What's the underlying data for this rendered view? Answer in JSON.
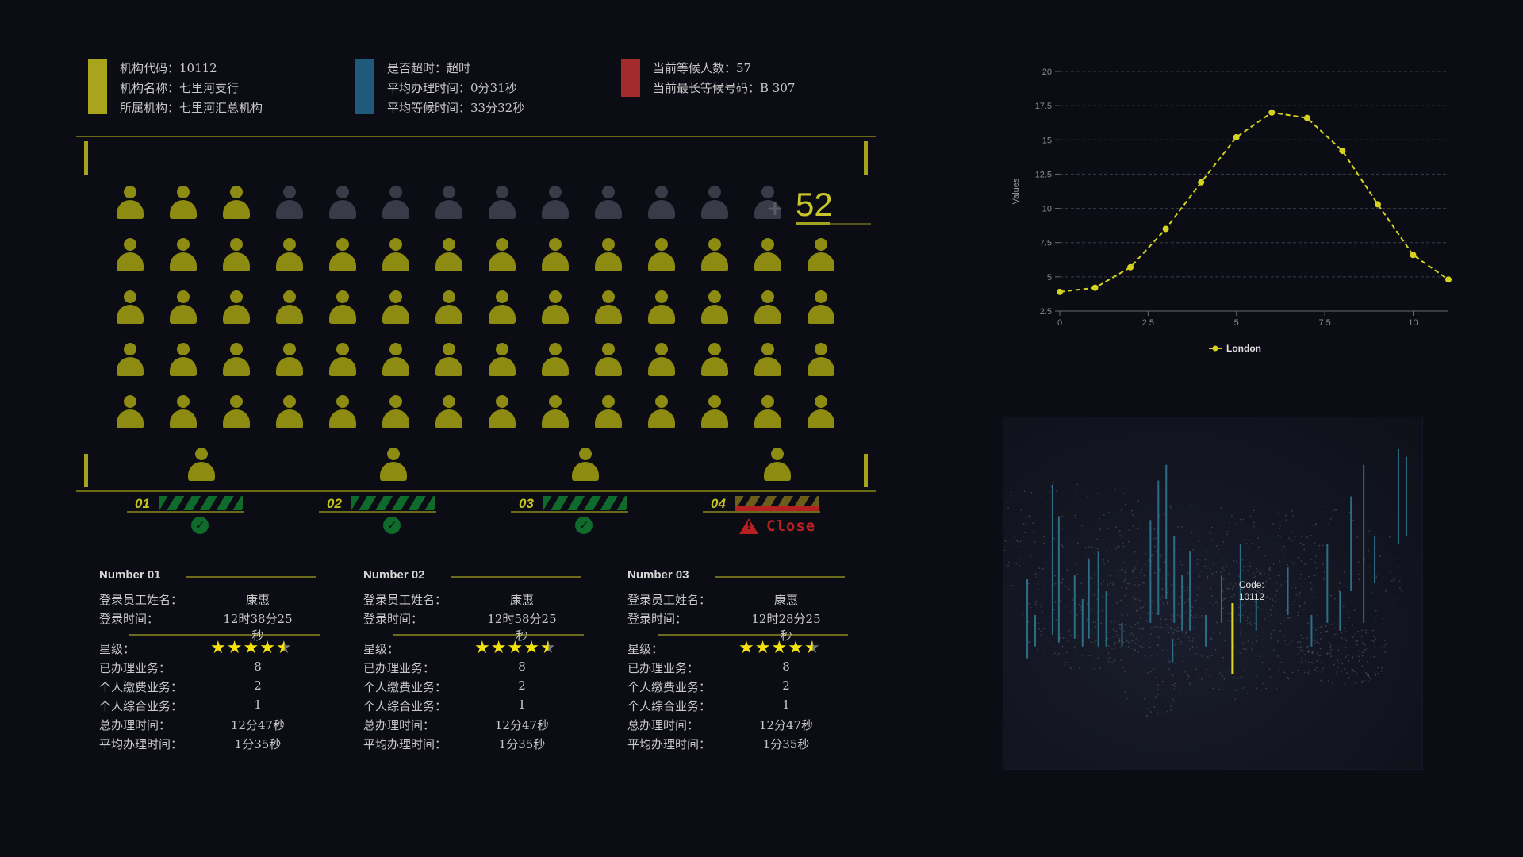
{
  "header": {
    "org": {
      "color": "#a8a51c",
      "lines": [
        "机构代码：10112",
        "机构名称：七里河支行",
        "所属机构：七里河汇总机构"
      ]
    },
    "timing": {
      "color": "#1e5b7a",
      "lines": [
        "是否超时：超时",
        "平均办理时间：0分31秒",
        "平均等候时间：33分32秒"
      ]
    },
    "queue": {
      "color": "#a32b2b",
      "lines": [
        "当前等候人数：57",
        "当前最长等候号码：B 307"
      ]
    }
  },
  "waiting": {
    "count": "52",
    "filled": 59,
    "total": 70,
    "plus_icon": "plus-icon",
    "on_color": "#8d8b12",
    "off_color": "#3a3b49"
  },
  "counters": [
    {
      "num": "01",
      "status": "open",
      "icon": "check-icon"
    },
    {
      "num": "02",
      "status": "open",
      "icon": "check-icon"
    },
    {
      "num": "03",
      "status": "open",
      "icon": "check-icon"
    },
    {
      "num": "04",
      "status": "closed",
      "icon": "warning-icon",
      "status_text": "Close"
    }
  ],
  "cards": [
    {
      "title": "Number 01",
      "name_label": "登录员工姓名：",
      "name": "康惠",
      "time_label": "登录时间：",
      "time": "12时38分25秒",
      "rating_label": "星级：",
      "rating": 4.5,
      "done_label": "已办理业务：",
      "done": "8",
      "pay_label": "个人缴费业务：",
      "pay": "2",
      "general_label": "个人综合业务：",
      "general": "1",
      "total_label": "总办理时间：",
      "total": "12分47秒",
      "avg_label": "平均办理时间：",
      "avg": "1分35秒"
    },
    {
      "title": "Number 02",
      "name_label": "登录员工姓名：",
      "name": "康惠",
      "time_label": "登录时间：",
      "time": "12时58分25秒",
      "rating_label": "星级：",
      "rating": 4.5,
      "done_label": "已办理业务：",
      "done": "8",
      "pay_label": "个人缴费业务：",
      "pay": "2",
      "general_label": "个人综合业务：",
      "general": "1",
      "total_label": "总办理时间：",
      "total": "12分47秒",
      "avg_label": "平均办理时间：",
      "avg": "1分35秒"
    },
    {
      "title": "Number 03",
      "name_label": "登录员工姓名：",
      "name": "康惠",
      "time_label": "登录时间：",
      "time": "12时28分25秒",
      "rating_label": "星级：",
      "rating": 4.5,
      "done_label": "已办理业务：",
      "done": "8",
      "pay_label": "个人缴费业务：",
      "pay": "2",
      "general_label": "个人综合业务：",
      "general": "1",
      "total_label": "总办理时间：",
      "total": "12分47秒",
      "avg_label": "平均办理时间：",
      "avg": "1分35秒"
    }
  ],
  "chart_data": {
    "type": "line",
    "title": "",
    "xlabel": "",
    "ylabel": "Values",
    "xlim": [
      0,
      11
    ],
    "ylim": [
      2.5,
      20
    ],
    "xticks": [
      "0",
      "2.5",
      "5",
      "7.5",
      "10"
    ],
    "yticks": [
      "2.5",
      "5",
      "7.5",
      "10",
      "12.5",
      "15",
      "17.5",
      "20"
    ],
    "grid": true,
    "legend": "bottom-center",
    "series": [
      {
        "name": "London",
        "color": "#d4d41e",
        "style": "dashed",
        "x": [
          0,
          1,
          2,
          3,
          4,
          5,
          6,
          7,
          8,
          9,
          10,
          11
        ],
        "y": [
          3.9,
          4.2,
          5.7,
          8.5,
          11.9,
          15.2,
          17.0,
          16.6,
          14.2,
          10.3,
          6.6,
          4.8
        ]
      }
    ]
  },
  "map": {
    "tooltip_label": "Code:",
    "tooltip_value": "10112",
    "bar_color": "#2a6f86",
    "highlight_color": "#e0d81a"
  }
}
